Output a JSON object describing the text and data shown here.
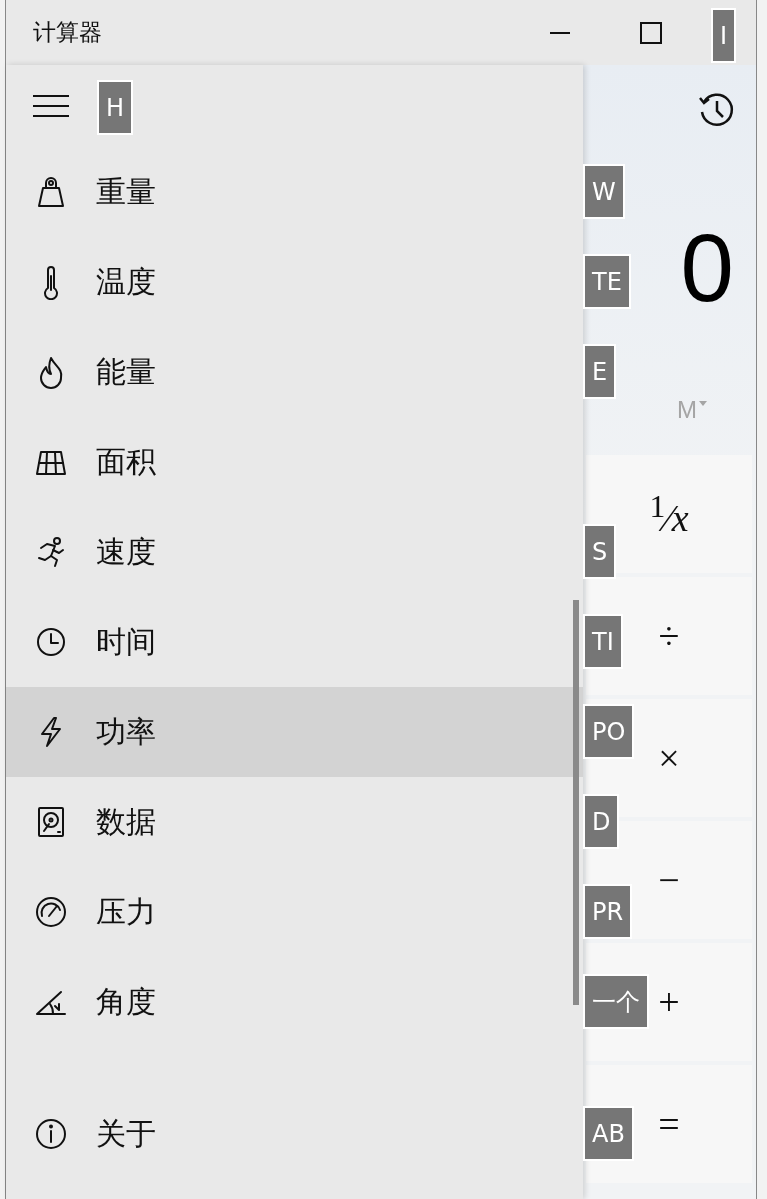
{
  "window": {
    "title": "计算器",
    "close_keytip": "I"
  },
  "nav": {
    "menu_keytip": "H",
    "items": [
      {
        "label": "重量",
        "keytip": "W",
        "selected": false
      },
      {
        "label": "温度",
        "keytip": "TE",
        "selected": false
      },
      {
        "label": "能量",
        "keytip": "E",
        "selected": false
      },
      {
        "label": "面积",
        "selected": false
      },
      {
        "label": "速度",
        "keytip": "S",
        "selected": false
      },
      {
        "label": "时间",
        "keytip": "TI",
        "selected": false
      },
      {
        "label": "功率",
        "keytip": "PO",
        "selected": true
      },
      {
        "label": "数据",
        "keytip": "D",
        "selected": false
      },
      {
        "label": "压力",
        "keytip": "PR",
        "selected": false
      },
      {
        "label": "角度",
        "keytip": "一个",
        "selected": false
      }
    ],
    "footer": {
      "label": "关于",
      "keytip": "AB"
    }
  },
  "calculator": {
    "display": "0",
    "memory": "M",
    "keys": [
      "$^{1}$⁄*x*",
      "÷",
      "×",
      "−",
      "+",
      "="
    ]
  }
}
